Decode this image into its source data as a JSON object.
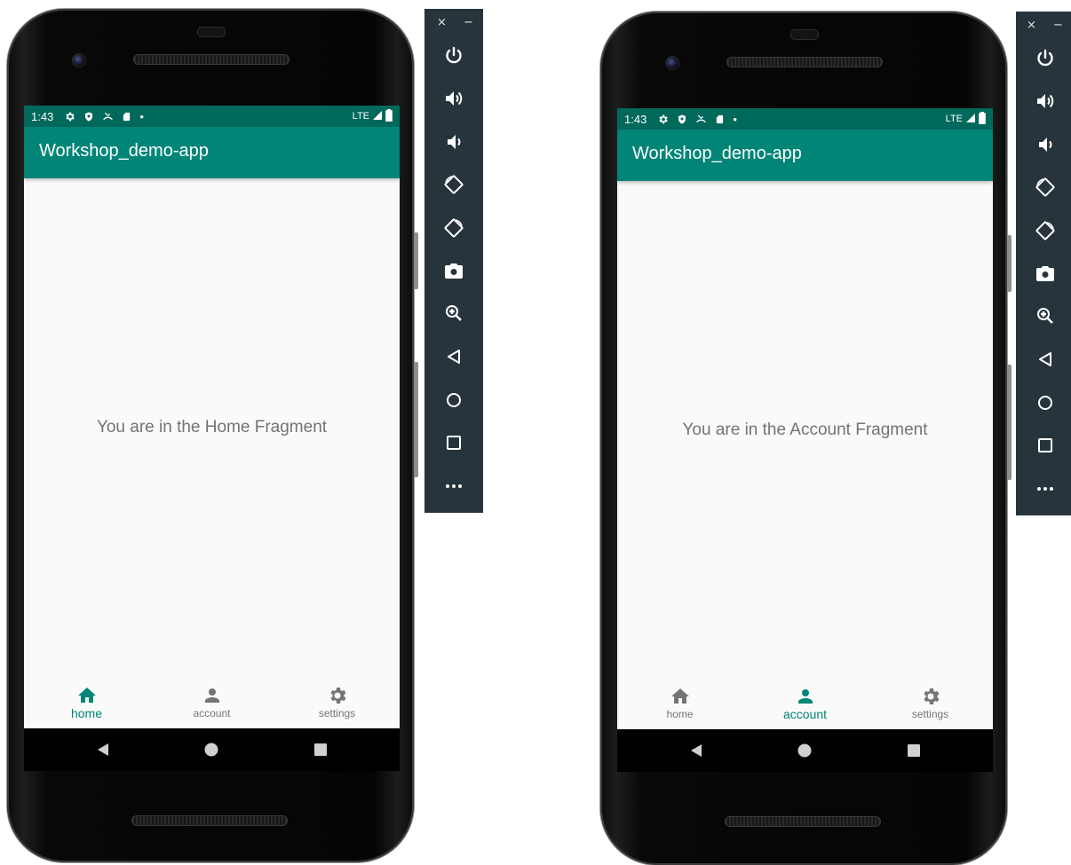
{
  "devices": [
    {
      "status": {
        "time": "1:43",
        "dot": "•",
        "network": "LTE"
      },
      "app_title": "Workshop_demo-app",
      "content_text": "You are in the Home Fragment",
      "nav": [
        {
          "label": "home",
          "icon": "home-icon",
          "active": true
        },
        {
          "label": "account",
          "icon": "account-icon",
          "active": false
        },
        {
          "label": "settings",
          "icon": "settings-icon",
          "active": false
        }
      ]
    },
    {
      "status": {
        "time": "1:43",
        "dot": "•",
        "network": "LTE"
      },
      "app_title": "Workshop_demo-app",
      "content_text": "You are in the Account Fragment",
      "nav": [
        {
          "label": "home",
          "icon": "home-icon",
          "active": false
        },
        {
          "label": "account",
          "icon": "account-icon",
          "active": true
        },
        {
          "label": "settings",
          "icon": "settings-icon",
          "active": false
        }
      ]
    }
  ],
  "emulator_toolbar": {
    "close": "×",
    "minimize": "−",
    "buttons": [
      "power-icon",
      "volume-up-icon",
      "volume-down-icon",
      "rotate-left-icon",
      "rotate-right-icon",
      "camera-icon",
      "zoom-icon",
      "back-icon",
      "home-circle-icon",
      "overview-icon",
      "more-icon"
    ]
  },
  "colors": {
    "status_bar": "#00695c",
    "app_bar": "#008577",
    "accent": "#008577",
    "inactive": "#757575",
    "screen_bg": "#fafafa",
    "toolbar_bg": "#27343b"
  }
}
